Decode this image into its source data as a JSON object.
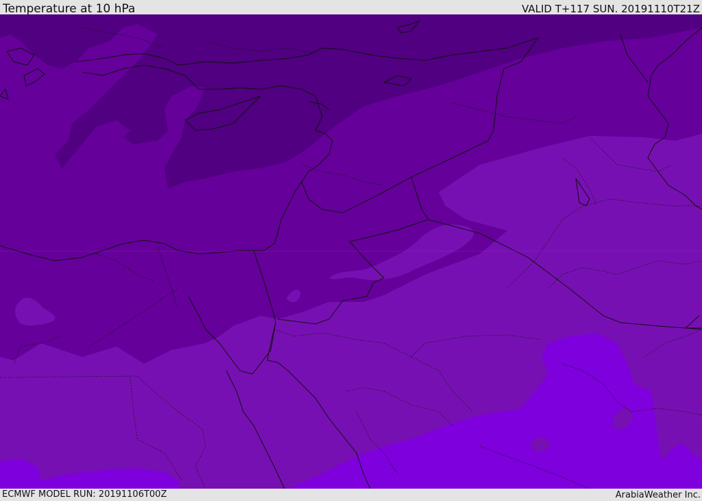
{
  "header": {
    "title": "Temperature at 10 hPa",
    "valid": "VALID T+117 SUN. 20191110T21Z"
  },
  "footer": {
    "model_run": "ECMWF MODEL RUN: 20191106T00Z",
    "brand": "ArabiaWeather Inc."
  },
  "colors": {
    "band_darkest": "#500080",
    "band_dark": "#65009a",
    "band_mid": "#7710b2",
    "band_light": "#7e00dc",
    "borders": "#000000",
    "background": "#e4e4e4"
  }
}
